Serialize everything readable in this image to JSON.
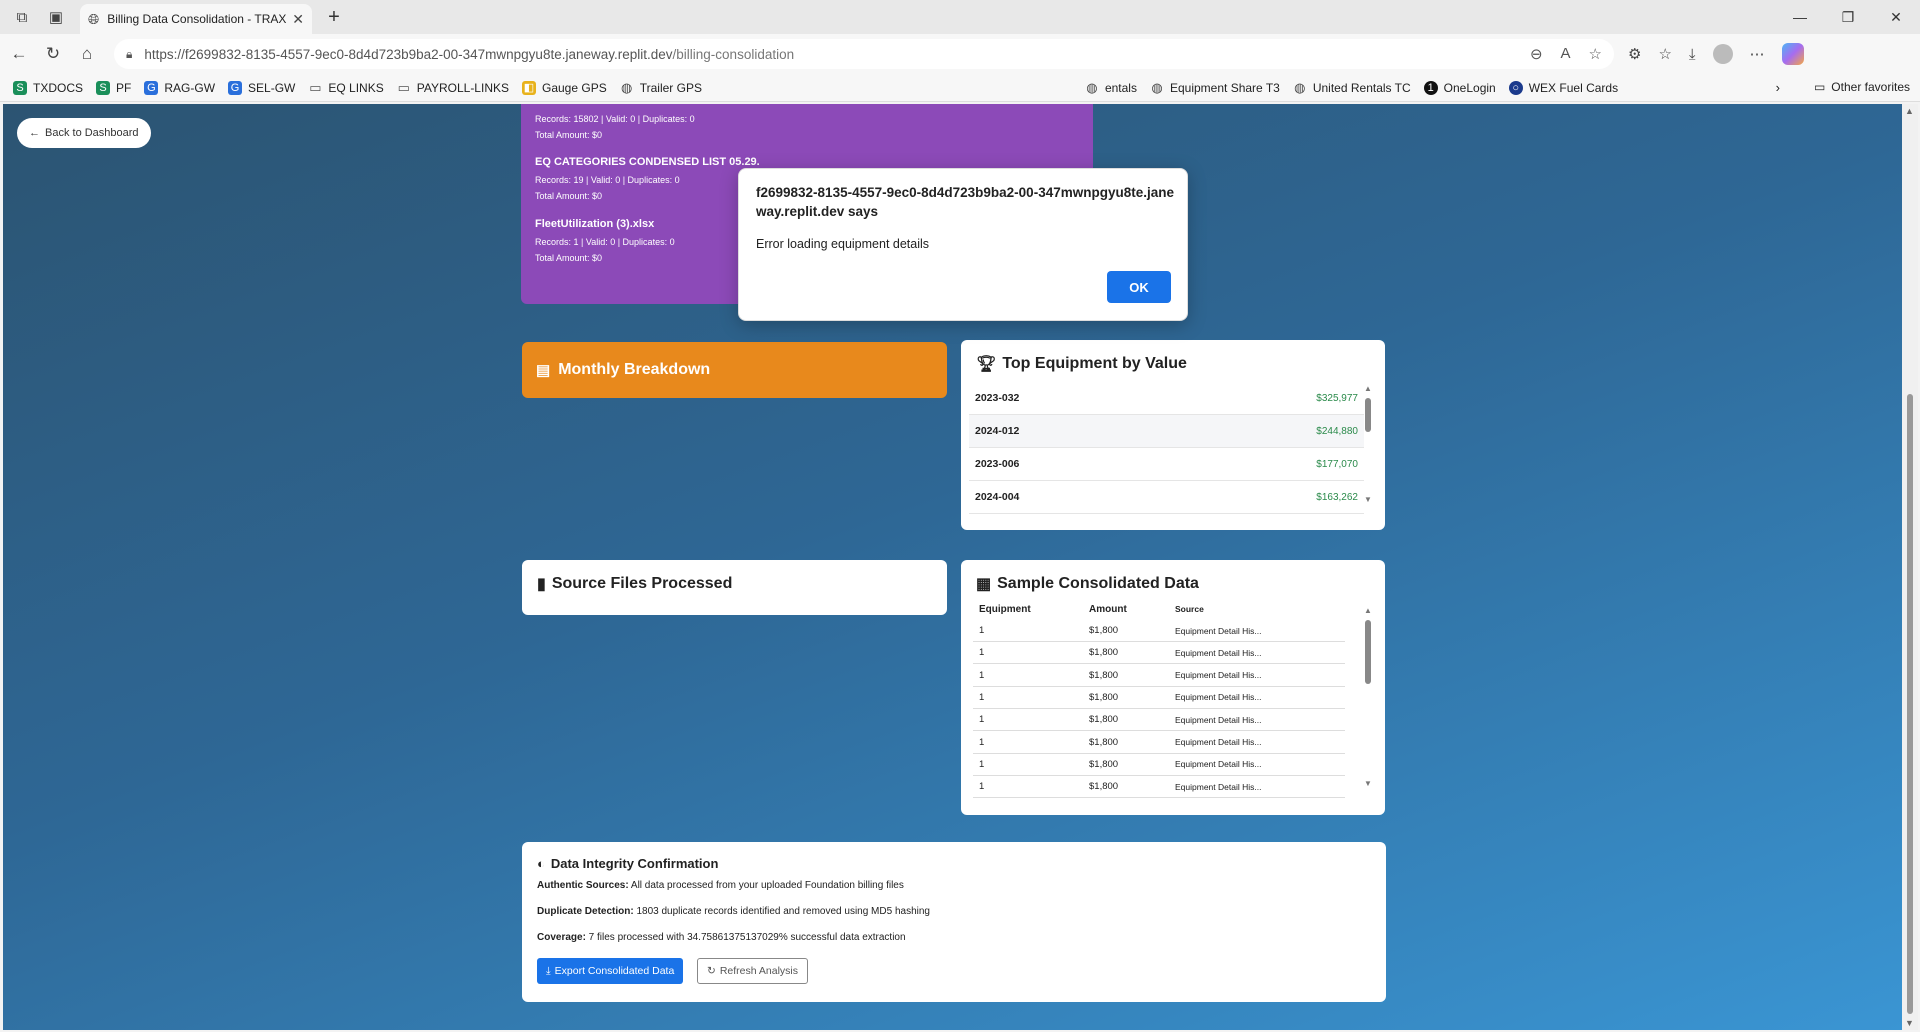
{
  "browser": {
    "tab_title": "Billing Data Consolidation - TRAX",
    "url_prefix": "https://f2699832-8135-4557-9ec0-8d4d723b9ba2-00-347mwnpgyu8te.janeway.replit.dev",
    "url_path": "/billing-consolidation",
    "bookmarks": [
      {
        "label": "TXDOCS",
        "icon": "green-s-icon",
        "color": "#1a8f5a"
      },
      {
        "label": "PF",
        "icon": "green-s-icon",
        "color": "#1a8f5a"
      },
      {
        "label": "RAG-GW",
        "icon": "g-icon",
        "color": "#2a6fdb"
      },
      {
        "label": "SEL-GW",
        "icon": "g-icon",
        "color": "#2a6fdb"
      },
      {
        "label": "EQ LINKS",
        "icon": "folder-icon",
        "color": "#555"
      },
      {
        "label": "PAYROLL-LINKS",
        "icon": "folder-icon",
        "color": "#555"
      },
      {
        "label": "Gauge GPS",
        "icon": "gauge-icon",
        "color": "#e8b21c"
      },
      {
        "label": "Trailer GPS",
        "icon": "globe-icon",
        "color": "#444"
      },
      {
        "label": "entals",
        "icon": "globe-icon",
        "color": "#444"
      },
      {
        "label": "Equipment Share T3",
        "icon": "globe-icon",
        "color": "#444"
      },
      {
        "label": "United Rentals TC",
        "icon": "globe-icon",
        "color": "#444"
      },
      {
        "label": "OneLogin",
        "icon": "onelogin-icon",
        "color": "#111"
      },
      {
        "label": "WEX Fuel Cards",
        "icon": "wex-icon",
        "color": "#1b3a8c"
      }
    ],
    "other_favorites": "Other favorites"
  },
  "page": {
    "back_label": "Back to Dashboard",
    "purple_files": [
      {
        "stats": "Records: 15802 | Valid: 0 | Duplicates: 0",
        "total": "Total Amount: $0"
      },
      {
        "name": "EQ CATEGORIES CONDENSED LIST 05.29.",
        "stats": "Records: 19 | Valid: 0 | Duplicates: 0",
        "total": "Total Amount: $0"
      },
      {
        "name": "FleetUtilization (3).xlsx",
        "stats": "Records: 1 | Valid: 0 | Duplicates: 0",
        "total": "Total Amount: $0"
      }
    ],
    "monthly_title": "Monthly Breakdown",
    "top_equipment": {
      "title": "Top Equipment by Value",
      "rows": [
        {
          "name": "2023-032",
          "value": "$325,977"
        },
        {
          "name": "2024-012",
          "value": "$244,880"
        },
        {
          "name": "2023-006",
          "value": "$177,070"
        },
        {
          "name": "2024-004",
          "value": "$163,262"
        }
      ]
    },
    "source_files_title": "Source Files Processed",
    "sample": {
      "title": "Sample Consolidated Data",
      "headers": [
        "Equipment",
        "Amount",
        "Source"
      ],
      "rows": [
        [
          "1",
          "$1,800",
          "Equipment Detail His..."
        ],
        [
          "1",
          "$1,800",
          "Equipment Detail His..."
        ],
        [
          "1",
          "$1,800",
          "Equipment Detail His..."
        ],
        [
          "1",
          "$1,800",
          "Equipment Detail His..."
        ],
        [
          "1",
          "$1,800",
          "Equipment Detail His..."
        ],
        [
          "1",
          "$1,800",
          "Equipment Detail His..."
        ],
        [
          "1",
          "$1,800",
          "Equipment Detail His..."
        ],
        [
          "1",
          "$1,800",
          "Equipment Detail His..."
        ]
      ]
    },
    "integrity": {
      "title": "Data Integrity Confirmation",
      "authentic_label": "Authentic Sources:",
      "authentic_text": " All data processed from your uploaded Foundation billing files",
      "duplicate_label": "Duplicate Detection:",
      "duplicate_text": " 1803 duplicate records identified and removed using MD5 hashing",
      "coverage_label": "Coverage:",
      "coverage_text": " 7 files processed with 34.75861375137029% successful data extraction",
      "export_label": "Export Consolidated Data",
      "refresh_label": "Refresh Analysis"
    }
  },
  "dialog": {
    "title": "f2699832-8135-4557-9ec0-8d4d723b9ba2-00-347mwnpgyu8te.janeway.replit.dev says",
    "message": "Error loading equipment details",
    "ok_label": "OK"
  }
}
